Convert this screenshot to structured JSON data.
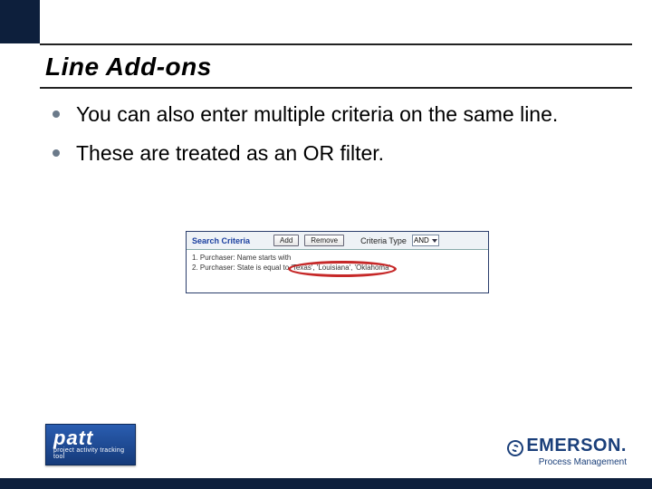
{
  "slide": {
    "title": "Line Add-ons",
    "bullets": [
      "You can also enter multiple criteria on the same line.",
      "These are treated as an OR filter."
    ]
  },
  "panel": {
    "header_title": "Search Criteria",
    "btn_add": "Add",
    "btn_remove": "Remove",
    "criteria_type_label": "Criteria Type",
    "criteria_type_value": "AND",
    "lines": [
      "1. Purchaser: Name starts with",
      "2. Purchaser: State is equal to 'Texas', 'Louisiana', 'Oklahoma'"
    ]
  },
  "branding": {
    "patt_main": "patt",
    "patt_tag": "project activity tracking tool",
    "emerson_name": "EMERSON.",
    "emerson_tag": "Process Management"
  }
}
